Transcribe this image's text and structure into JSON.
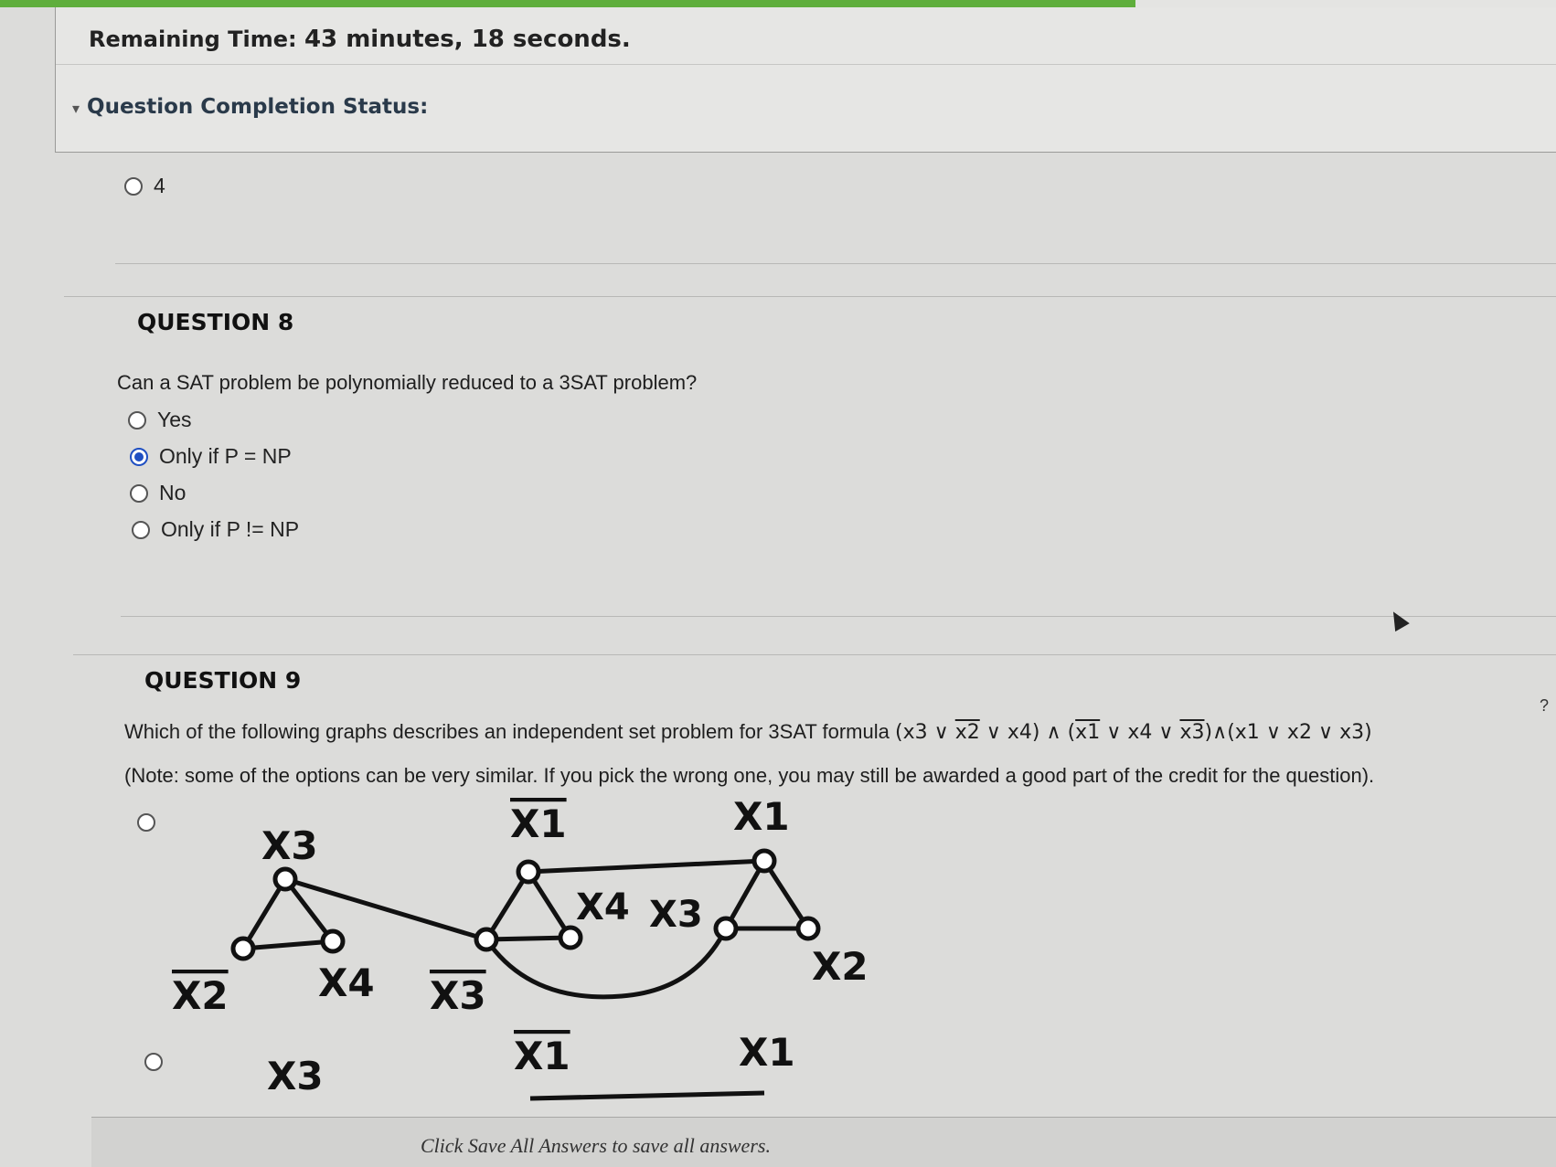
{
  "timer": {
    "label": "Remaining Time:",
    "value": "43 minutes, 18 seconds.",
    "progress_fraction": 0.73
  },
  "status": {
    "label": "Question Completion Status:"
  },
  "prev_question": {
    "option_label": "4"
  },
  "q8": {
    "title": "QUESTION 8",
    "text": "Can a SAT problem be polynomially reduced to a 3SAT problem?",
    "options": [
      {
        "label": "Yes",
        "selected": false
      },
      {
        "label": "Only if P = NP",
        "selected": true
      },
      {
        "label": "No",
        "selected": false
      },
      {
        "label": "Only if P != NP",
        "selected": false
      }
    ]
  },
  "q9": {
    "title": "QUESTION 9",
    "text": "Which of the following graphs describes an independent set problem for 3SAT formula",
    "formula": {
      "c1": [
        "x3",
        "x2",
        "x4"
      ],
      "c2": [
        "x1",
        "x4",
        "x3"
      ],
      "c3": [
        "x1",
        "x2",
        "x3"
      ],
      "or": "∨",
      "and": "∧"
    },
    "help": "?",
    "note": "(Note: some of the options can be very similar. If you pick the wrong one, you may still be awarded a good part of the credit for the question).",
    "graph1_labels": {
      "x3_top": "X3",
      "x2_bar": "X2",
      "x4_a": "X4",
      "x3_bar": "X3",
      "x1_bar_top": "X1",
      "x4_mid": "X4",
      "x3_mid": "X3",
      "x1_top": "X1",
      "x2_right": "X2"
    },
    "graph2_labels": {
      "x3": "X3",
      "x1_bar": "X1",
      "x1": "X1"
    }
  },
  "footer": {
    "text": "Click Save All Answers to save all answers."
  }
}
